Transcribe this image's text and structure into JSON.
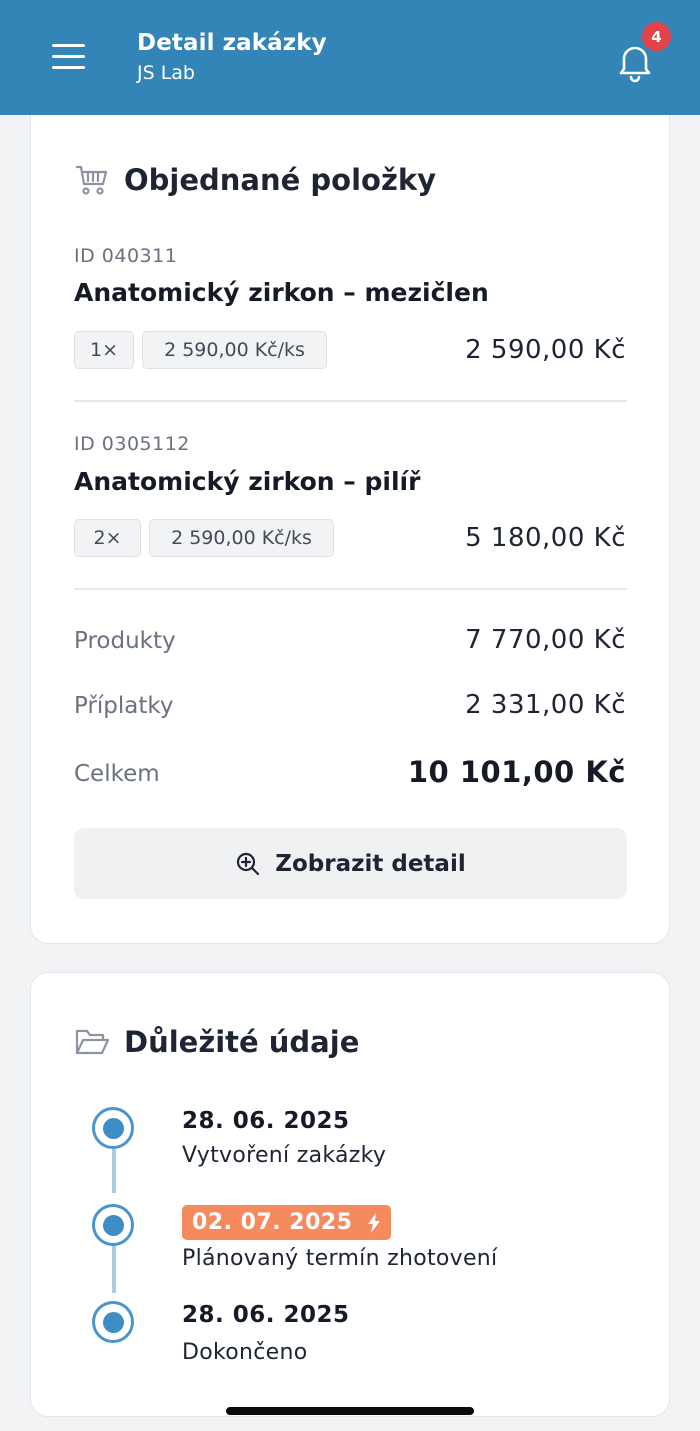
{
  "header": {
    "title": "Detail zakázky",
    "subtitle": "JS Lab",
    "notification_count": "4",
    "color": "#3385b8"
  },
  "ordered_items": {
    "title": "Objednané položky",
    "icon": "cart-icon",
    "items": [
      {
        "id": "ID 040311",
        "name": "Anatomický zirkon – mezičlen",
        "quantity": "1×",
        "unit_price": "2 590,00 Kč/ks",
        "total": "2 590,00 Kč"
      },
      {
        "id": "ID 0305112",
        "name": "Anatomický zirkon – pilíř",
        "quantity": "2×",
        "unit_price": "2 590,00 Kč/ks",
        "total": "5 180,00 Kč"
      }
    ],
    "summary": {
      "products_label": "Produkty",
      "products_value": "7 770,00 Kč",
      "surcharges_label": "Příplatky",
      "surcharges_value": "2 331,00 Kč",
      "total_label": "Celkem",
      "total_value": "10 101,00 Kč"
    },
    "detail_button": "Zobrazit detail"
  },
  "important": {
    "title": "Důležité údaje",
    "icon": "folder-open-icon",
    "timeline": [
      {
        "date": "28. 06. 2025",
        "label": "Vytvoření zakázky"
      },
      {
        "date": "02. 07. 2025",
        "label": "Plánovaný termín zhotovení",
        "highlight_color": "#f58a5f",
        "icon": "lightning-icon"
      },
      {
        "date": "28. 06. 2025",
        "label": "Dokončeno"
      }
    ]
  }
}
